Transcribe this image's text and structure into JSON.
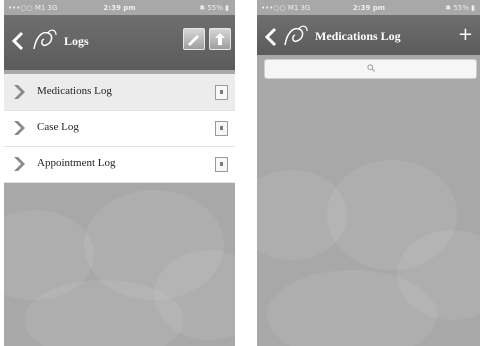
{
  "left_screen": {
    "status": {
      "carrier": "•••○○ M1 3G",
      "time": "2:39 pm",
      "battery": "✱ 55% ▮"
    },
    "nav": {
      "title": "Logs"
    },
    "rows": [
      {
        "label": "Medications Log"
      },
      {
        "label": "Case Log"
      },
      {
        "label": "Appointment Log"
      }
    ]
  },
  "right_screen": {
    "status": {
      "carrier": "•••○○ M1 3G",
      "time": "2:39 pm",
      "battery": "✱ 55% ▮"
    },
    "nav": {
      "title": "Medications Log",
      "add_label": "+"
    },
    "search": {
      "placeholder": ""
    }
  },
  "colors": {
    "navbar": "#616161",
    "background": "#a8a8a8",
    "list_bg": "#ffffff",
    "chevron": "#8a8a8a"
  },
  "icons": {
    "back": "chevron-left-icon",
    "logo": "app-logo-icon",
    "row_arrow": "chevron-right-icon",
    "row_doc": "document-icon",
    "search": "search-icon"
  }
}
